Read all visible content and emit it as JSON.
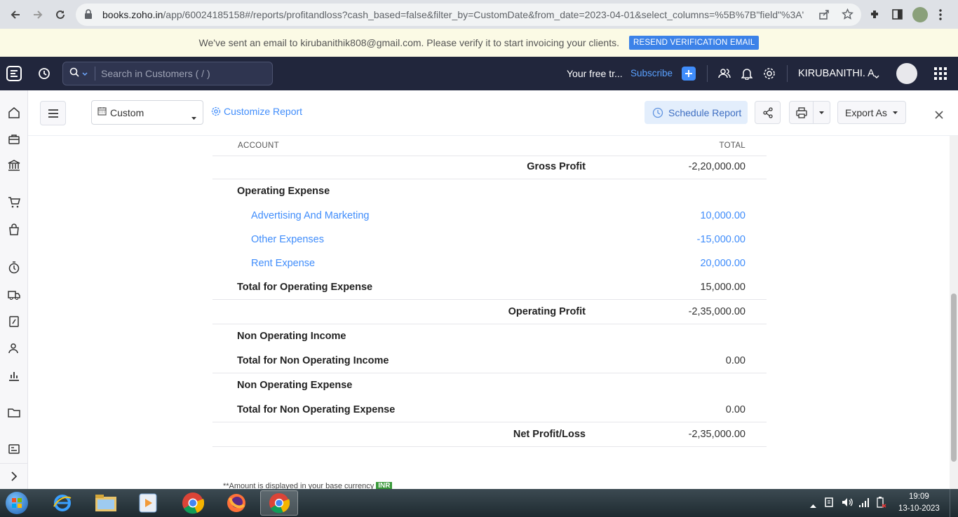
{
  "browser": {
    "url_host": "books.zoho.in",
    "url_path": "/app/60024185158#/reports/profitandloss?cash_based=false&filter_by=CustomDate&from_date=2023-04-01&select_columns=%5B%7B\"field\"%3A\"..."
  },
  "banner": {
    "message": "We've sent an email to kirubanithik808@gmail.com. Please verify it to start invoicing your clients.",
    "resend_label": "RESEND VERIFICATION EMAIL"
  },
  "topnav": {
    "search_placeholder": "Search in Customers ( / )",
    "trial_text": "Your free tr...",
    "subscribe_label": "Subscribe",
    "user_name": "KIRUBANITHI. A"
  },
  "toolbar": {
    "filter_value": "Custom",
    "customize_label": "Customize Report",
    "schedule_label": "Schedule Report",
    "export_label": "Export As"
  },
  "report": {
    "col_account": "ACCOUNT",
    "col_total": "TOTAL",
    "gross_profit_label": "Gross Profit",
    "gross_profit_value": "-2,20,000.00",
    "opex_header": "Operating Expense",
    "opex_items": [
      {
        "label": "Advertising And Marketing",
        "value": "10,000.00"
      },
      {
        "label": "Other Expenses",
        "value": "-15,000.00"
      },
      {
        "label": "Rent Expense",
        "value": "20,000.00"
      }
    ],
    "opex_total_label": "Total for Operating Expense",
    "opex_total_value": "15,000.00",
    "operating_profit_label": "Operating Profit",
    "operating_profit_value": "-2,35,000.00",
    "noi_header": "Non Operating Income",
    "noi_total_label": "Total for Non Operating Income",
    "noi_total_value": "0.00",
    "noe_header": "Non Operating Expense",
    "noe_total_label": "Total for Non Operating Expense",
    "noe_total_value": "0.00",
    "net_label": "Net Profit/Loss",
    "net_value": "-2,35,000.00",
    "footnote": "**Amount is displayed in your base currency",
    "currency_badge": "INR"
  },
  "taskbar": {
    "time": "19:09",
    "date": "13-10-2023"
  }
}
